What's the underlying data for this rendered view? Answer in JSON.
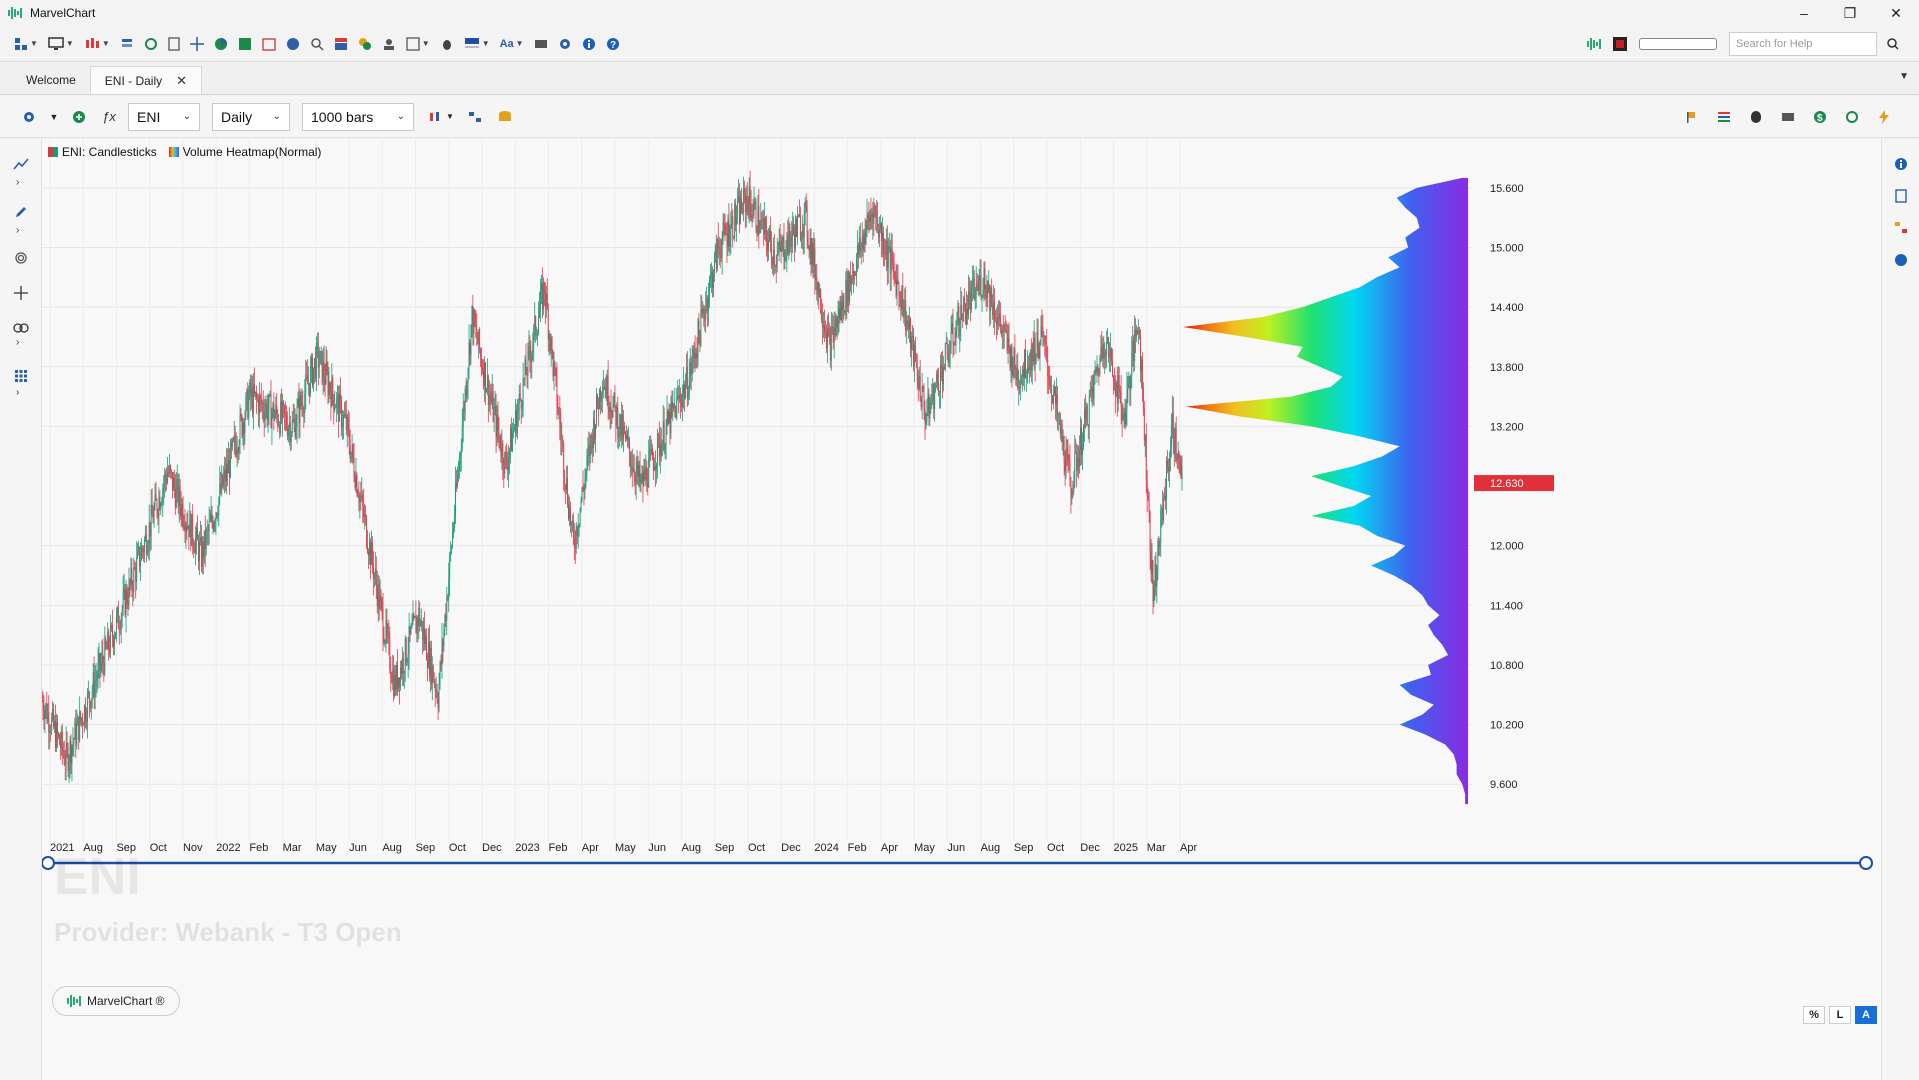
{
  "window": {
    "title": "MarvelChart",
    "controls": {
      "minimize": "–",
      "restore": "❐",
      "close": "✕"
    }
  },
  "toolbar": {
    "search_placeholder": "Search for Help",
    "icons": [
      "workspace-icon",
      "monitor-icon",
      "chart-type-icon",
      "layers-icon",
      "refresh-icon",
      "document-icon",
      "crosshair-icon",
      "pie-icon",
      "calendar-green-icon",
      "calendar-icon",
      "globe-icon",
      "search-user-icon",
      "table-icon",
      "cluster-icon",
      "user-pin-icon",
      "layout-icon",
      "bug-icon",
      "color-icon",
      "font-icon",
      "keyboard-icon",
      "settings-icon",
      "info-icon",
      "help-icon"
    ]
  },
  "tabs": [
    {
      "label": "Welcome",
      "active": false
    },
    {
      "label": "ENI - Daily",
      "active": true,
      "close": "✕"
    }
  ],
  "chart_toolbar": {
    "symbol": "ENI",
    "timeframe": "Daily",
    "bars": "1000 bars"
  },
  "legend": [
    {
      "label": "ENI: Candlesticks",
      "color": "#d83a3a"
    },
    {
      "label": "Volume Heatmap(Normal)",
      "color": "#7b3ff2"
    }
  ],
  "watermark": {
    "symbol": "ENI",
    "provider": "Provider: Webank - T3 Open"
  },
  "brand_pill": "MarvelChart ®",
  "scale_buttons": [
    {
      "label": "%",
      "active": false
    },
    {
      "label": "L",
      "active": false
    },
    {
      "label": "A",
      "active": true
    }
  ],
  "colors": {
    "up": "#1a9a7a",
    "down": "#e03a4a",
    "last_price_bg": "#e0303a",
    "accent": "#1a6fd6"
  },
  "chart_data": {
    "type": "candlestick",
    "symbol": "ENI",
    "timeframe": "Daily",
    "ylim": [
      9.25,
      15.85
    ],
    "y_ticks": [
      "15.600",
      "15.000",
      "14.400",
      "13.800",
      "13.200",
      "12.000",
      "11.400",
      "10.800",
      "10.200",
      "9.600"
    ],
    "last_price": "12.630",
    "x_ticks": [
      "2021",
      "Aug",
      "Sep",
      "Oct",
      "Nov",
      "2022",
      "Feb",
      "Mar",
      "May",
      "Jun",
      "Aug",
      "Sep",
      "Oct",
      "Dec",
      "2023",
      "Feb",
      "Apr",
      "May",
      "Jun",
      "Aug",
      "Sep",
      "Oct",
      "Dec",
      "2024",
      "Feb",
      "Apr",
      "May",
      "Jun",
      "Aug",
      "Sep",
      "Oct",
      "Dec",
      "2025",
      "Mar",
      "Apr"
    ],
    "price_path_anchors": [
      [
        0,
        10.45
      ],
      [
        25,
        9.85
      ],
      [
        90,
        11.55
      ],
      [
        130,
        12.75
      ],
      [
        165,
        11.9
      ],
      [
        215,
        13.5
      ],
      [
        260,
        13.2
      ],
      [
        285,
        13.9
      ],
      [
        315,
        13.2
      ],
      [
        335,
        12.2
      ],
      [
        365,
        10.6
      ],
      [
        390,
        11.3
      ],
      [
        410,
        10.5
      ],
      [
        445,
        14.3
      ],
      [
        480,
        12.8
      ],
      [
        520,
        14.6
      ],
      [
        550,
        12.0
      ],
      [
        580,
        13.7
      ],
      [
        620,
        12.6
      ],
      [
        670,
        13.7
      ],
      [
        700,
        15.0
      ],
      [
        730,
        15.5
      ],
      [
        760,
        14.9
      ],
      [
        790,
        15.3
      ],
      [
        815,
        14.0
      ],
      [
        860,
        15.4
      ],
      [
        890,
        14.5
      ],
      [
        915,
        13.3
      ],
      [
        950,
        14.3
      ],
      [
        975,
        14.7
      ],
      [
        1010,
        13.7
      ],
      [
        1035,
        14.1
      ],
      [
        1065,
        12.6
      ],
      [
        1100,
        14.1
      ],
      [
        1120,
        13.3
      ],
      [
        1135,
        14.3
      ],
      [
        1150,
        11.5
      ],
      [
        1170,
        13.2
      ],
      [
        1180,
        12.63
      ]
    ],
    "volume_profile": {
      "type": "heatmap-profile",
      "price_levels": [
        15.7,
        15.6,
        15.5,
        15.4,
        15.3,
        15.2,
        15.1,
        15.0,
        14.9,
        14.8,
        14.7,
        14.6,
        14.5,
        14.4,
        14.3,
        14.2,
        14.1,
        14.0,
        13.9,
        13.8,
        13.7,
        13.6,
        13.5,
        13.4,
        13.3,
        13.2,
        13.1,
        13.0,
        12.9,
        12.8,
        12.7,
        12.6,
        12.5,
        12.4,
        12.3,
        12.2,
        12.1,
        12.0,
        11.9,
        11.8,
        11.7,
        11.6,
        11.5,
        11.4,
        11.3,
        11.2,
        11.1,
        11.0,
        10.9,
        10.8,
        10.7,
        10.6,
        10.5,
        10.4,
        10.3,
        10.2,
        10.1,
        10.0,
        9.9,
        9.8,
        9.7,
        9.6,
        9.5,
        9.4
      ],
      "volumes": [
        0.02,
        0.18,
        0.25,
        0.22,
        0.18,
        0.17,
        0.22,
        0.21,
        0.28,
        0.24,
        0.32,
        0.38,
        0.48,
        0.58,
        0.72,
        1.0,
        0.78,
        0.58,
        0.6,
        0.52,
        0.44,
        0.48,
        0.62,
        0.99,
        0.8,
        0.55,
        0.38,
        0.24,
        0.3,
        0.4,
        0.55,
        0.45,
        0.34,
        0.4,
        0.55,
        0.38,
        0.32,
        0.22,
        0.26,
        0.34,
        0.26,
        0.2,
        0.16,
        0.14,
        0.1,
        0.14,
        0.12,
        0.09,
        0.07,
        0.14,
        0.13,
        0.24,
        0.2,
        0.12,
        0.16,
        0.24,
        0.15,
        0.08,
        0.05,
        0.04,
        0.04,
        0.02,
        0.01,
        0.01
      ]
    }
  }
}
